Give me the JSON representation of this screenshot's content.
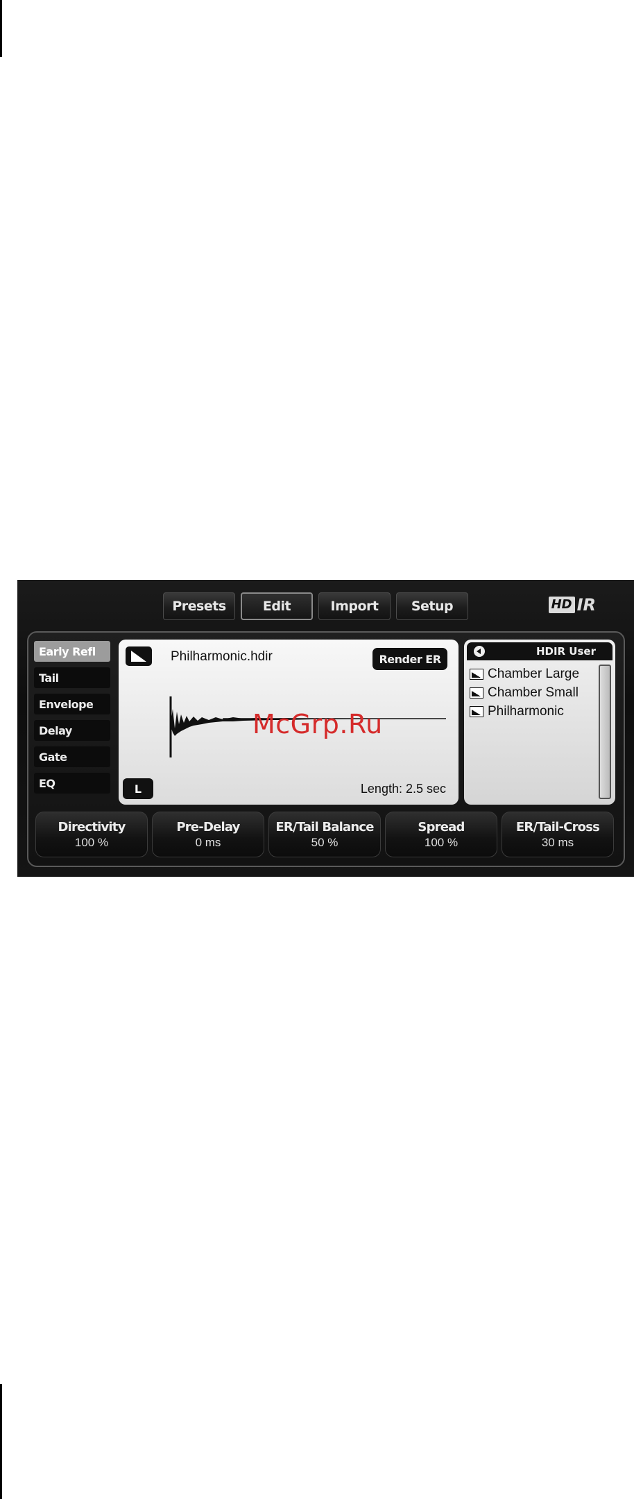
{
  "header": {
    "tabs": [
      {
        "label": "Presets"
      },
      {
        "label": "Edit",
        "active": true
      },
      {
        "label": "Import"
      },
      {
        "label": "Setup"
      }
    ],
    "logo": {
      "hd": "HD",
      "ir": "IR"
    }
  },
  "sidebar": {
    "items": [
      {
        "label": "Early Refl",
        "active": true
      },
      {
        "label": "Tail"
      },
      {
        "label": "Envelope"
      },
      {
        "label": "Delay"
      },
      {
        "label": "Gate"
      },
      {
        "label": "EQ"
      }
    ]
  },
  "display": {
    "file_name": "Philharmonic.hdir",
    "render_label": "Render ER",
    "channel_label": "L",
    "length_label": "Length: 2.5 sec",
    "watermark": "McGrp.Ru",
    "mode_icon": "ramp-icon"
  },
  "browser": {
    "title": "HDIR User",
    "items": [
      {
        "label": "Chamber Large"
      },
      {
        "label": "Chamber Small"
      },
      {
        "label": "Philharmonic"
      }
    ]
  },
  "params": [
    {
      "label": "Directivity",
      "value": "100 %"
    },
    {
      "label": "Pre-Delay",
      "value": "0 ms"
    },
    {
      "label": "ER/Tail Balance",
      "value": "50 %"
    },
    {
      "label": "Spread",
      "value": "100 %"
    },
    {
      "label": "ER/Tail-Cross",
      "value": "30 ms"
    }
  ],
  "colors": {
    "panel": "#121212",
    "display_bg": "#eeeeee",
    "active_tab": "#9c9c9c",
    "watermark": "#d52b2b"
  }
}
